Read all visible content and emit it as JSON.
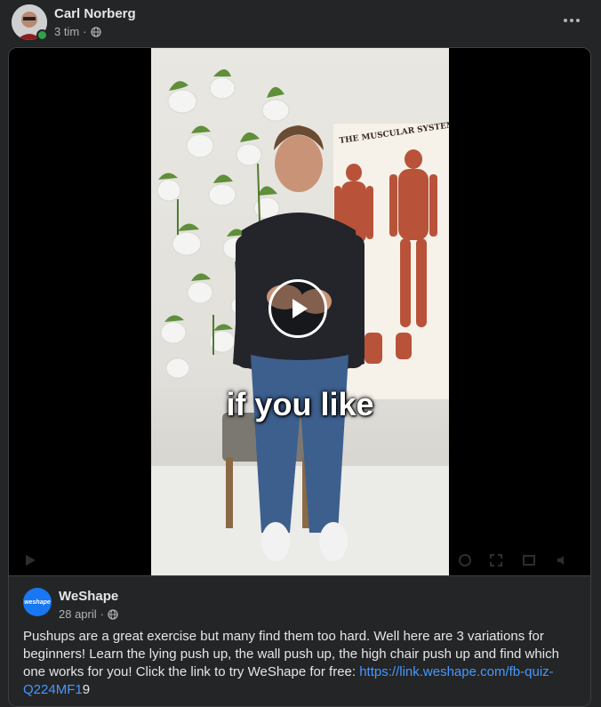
{
  "post": {
    "author": "Carl Norberg",
    "time": "3 tim",
    "separator": "·",
    "privacy_icon": "globe-icon",
    "more_icon": "more-dots-icon"
  },
  "video": {
    "caption": "if you like",
    "chart_title": "THE MUSCULAR SYSTEM",
    "play_icon": "play-icon"
  },
  "shared_post": {
    "page_name": "WeShape",
    "logo_text": "weshape",
    "date": "28 april",
    "separator": "·",
    "privacy_icon": "globe-icon",
    "text": "Pushups are a great exercise but many find them too hard. Well here are 3 variations for beginners! Learn the lying push up, the wall push up, the high chair push up and find which one works for you! Click the link to try WeShape for free: ",
    "link": "https://link.weshape.com/fb-quiz-Q224MF1",
    "link_suffix": "9"
  },
  "colors": {
    "background": "#242526",
    "link": "#4599ff",
    "online": "#31a24c",
    "brand": "#1877f2"
  }
}
